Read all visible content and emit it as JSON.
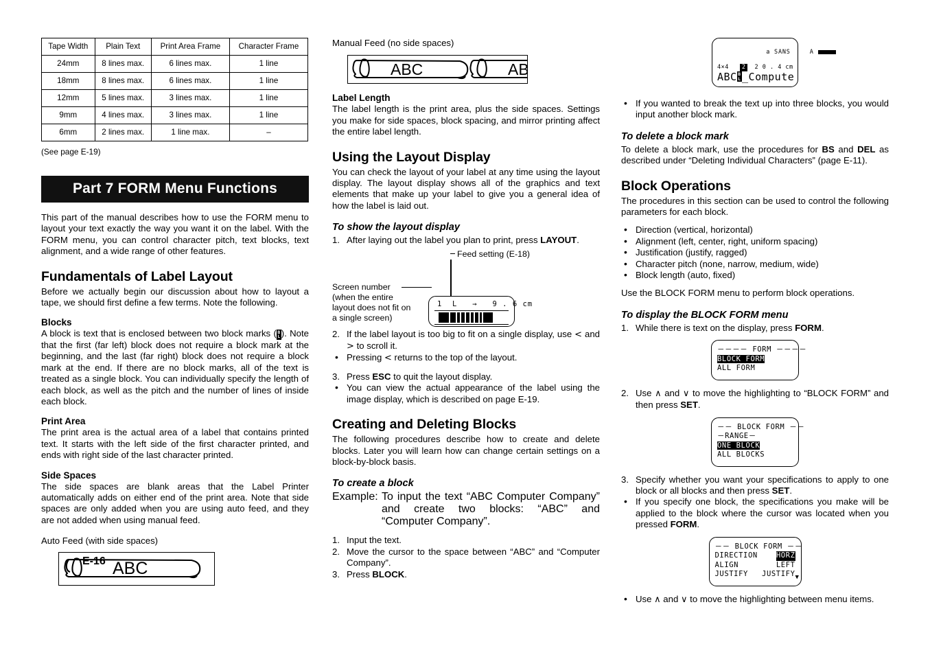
{
  "page": {
    "number": "E-16"
  },
  "table": {
    "headers": [
      "Tape Width",
      "Plain Text",
      "Print Area Frame",
      "Character Frame"
    ],
    "rows": [
      [
        "24mm",
        "8 lines max.",
        "6 lines max.",
        "1 line"
      ],
      [
        "18mm",
        "8 lines max.",
        "6 lines max.",
        "1 line"
      ],
      [
        "12mm",
        "5 lines max.",
        "3 lines max.",
        "1 line"
      ],
      [
        "9mm",
        "4 lines max.",
        "3 lines max.",
        "1 line"
      ],
      [
        "6mm",
        "2 lines max.",
        "1 line max.",
        "–"
      ]
    ],
    "note": "(See page E-19)"
  },
  "part_banner": "Part 7  FORM Menu Functions",
  "intro": "This part of the manual describes how to use the FORM menu to layout your text exactly the way you want it on the label. With the FORM menu, you can control character pitch, text blocks, text alignment, and a wide range of other features.",
  "fundamentals": {
    "heading": "Fundamentals of Label Layout",
    "intro": "Before we actually begin our discussion about how to layout a tape, we should first define a few terms. Note the following.",
    "blocks": {
      "heading": "Blocks",
      "text_before_mark": "A block is text that is enclosed between two block marks (",
      "text_after_mark": "). Note that the first (far left) block does not require a block mark at the beginning, and the last (far right) block does not require a block mark at the end. If there are no block marks, all of the text is treated as a single block. You can individually specify the length of each block, as well as the pitch and the number of lines of inside each block."
    },
    "print_area": {
      "heading": "Print Area",
      "text": "The print area is the actual area of a label that contains printed text. It starts with the left side of the first character printed, and ends with right side of the last character printed."
    },
    "side_spaces": {
      "heading": "Side Spaces",
      "text": "The side spaces are blank areas that the Label Printer automatically adds on either end of the print area. Note that side spaces are only added when you are using auto feed, and they are not added when using manual feed."
    },
    "auto_feed_caption": "Auto Feed (with side spaces)",
    "auto_feed_tape_text": "ABC"
  },
  "col2": {
    "manual_feed_caption": "Manual Feed (no side spaces)",
    "manual_feed_tape_text_1": "ABC",
    "manual_feed_tape_text_2": "AB",
    "label_length": {
      "heading": "Label Length",
      "text": "The label length is the print area, plus the side spaces. Settings you make for side spaces, block spacing, and mirror printing affect the entire label length."
    },
    "layout_display": {
      "heading": "Using the Layout Display",
      "text": "You can check the layout of your label at any time using the layout display. The layout display shows all of the graphics and text elements that make up your label to give you a general idea of how the label is laid out.",
      "subheading": "To show the layout display",
      "step1_pre": "After laying out the label you plan to print, press ",
      "step1_key": "LAYOUT",
      "step1_post": ".",
      "step1_num": "1.",
      "callout_feed": "Feed setting (E-18)",
      "callout_screen": "Screen number",
      "callout_screen_2": "(when the entire",
      "callout_screen_3": "layout does not fit on",
      "callout_screen_4": "a single screen)",
      "lcd_line": "1  L   →   9 . 6 cm",
      "step2_num": "2.",
      "step2_a": "If the label layout is too big to fit on a single display, use ",
      "step2_left_icon": "<",
      "step2_b": " and ",
      "step2_right_icon": ">",
      "step2_c": " to scroll it.",
      "bullet2_a": "Pressing ",
      "bullet2_b": " returns to the top of the layout.",
      "step3_num": "3.",
      "step3_a": "Press ",
      "step3_key": "ESC",
      "step3_b": " to quit the layout display.",
      "bullet3": "You can view the actual appearance of the label using the image display, which is described on page E-19."
    },
    "creating": {
      "heading": "Creating and Deleting Blocks",
      "text": "The following procedures describe how to create and delete blocks. Later you will learn how can change certain settings on a block-by-block basis.",
      "subheading": "To create a block",
      "example_label": "Example:",
      "example_text": "To input the text “ABC Computer Company” and create two blocks: “ABC” and “Computer Company”.",
      "step1_num": "1.",
      "step1": "Input the text.",
      "step2_num": "2.",
      "step2": "Move the cursor to the space between “ABC” and “Computer Company”.",
      "step3_num": "3.",
      "step3_a": "Press ",
      "step3_key": "BLOCK",
      "step3_b": "."
    }
  },
  "col3": {
    "abc_lcd": {
      "r1_left": "a SANS",
      "r1_right": "A",
      "r2_left": "4×4",
      "r2_inv": "2",
      "r2_right": "2 0 . 4 cm",
      "r3_text_a": "ABC",
      "r3_mark_top": "B",
      "r3_mark_bottom": "L",
      "r3_text_b": "_Compute"
    },
    "bullet_three_blocks": "If you wanted to break the text up into three blocks, you would input another block mark.",
    "delete_block_mark": {
      "heading": "To delete a block mark",
      "text_a": "To delete a block mark, use the procedures for ",
      "key_bs": "BS",
      "text_b": " and ",
      "key_del": "DEL",
      "text_c": " as described under “Deleting Individual Characters” (page E-11)."
    },
    "block_operations": {
      "heading": "Block Operations",
      "intro": "The procedures in this section can be used to control the following parameters for each block.",
      "params": [
        "Direction (vertical, horizontal)",
        "Alignment (left, center, right, uniform spacing)",
        "Justification (justify, ragged)",
        "Character pitch (none, narrow, medium, wide)",
        "Block length (auto, fixed)"
      ],
      "closing": "Use the BLOCK FORM menu to perform block operations.",
      "subheading": "To display the BLOCK FORM menu",
      "step1_num": "1.",
      "step1_a": "While there is text on the display, press ",
      "step1_key": "FORM",
      "step1_b": ".",
      "menu1": {
        "title": "－－－－ FORM －－－－",
        "item1": "BLOCK FORM",
        "item2": "ALL FORM"
      },
      "step2_num": "2.",
      "step2_a": "Use ",
      "step2_up": "∧",
      "step2_b": " and ",
      "step2_down": "∨",
      "step2_c": " to move the highlighting to “BLOCK FORM” and then press ",
      "step2_key": "SET",
      "step2_d": ".",
      "menu2": {
        "title": "－－ BLOCK FORM －－",
        "range": "－RANGE－",
        "item1": "ONE BLOCK",
        "item2": "ALL BLOCKS"
      },
      "step3_num": "3.",
      "step3_a": "Specify whether you want your specifications to apply to one block or all blocks and then press ",
      "step3_key": "SET",
      "step3_b": ".",
      "bullet3_a": "If you specify one block, the specifications you make will be applied to the block where the cursor was located when you pressed ",
      "bullet3_key": "FORM",
      "bullet3_b": ".",
      "menu3": {
        "title": "－－ BLOCK FORM －－",
        "row1_label": "DIRECTION",
        "row1_value": "HORZ",
        "row2_label": "ALIGN",
        "row2_value": "LEFT",
        "row3_label": "JUSTIFY",
        "row3_value": "JUSTIFY"
      },
      "bullet4_a": "Use ",
      "bullet4_up": "∧",
      "bullet4_b": " and ",
      "bullet4_down": "∨",
      "bullet4_c": " to move the highlighting between menu items."
    }
  }
}
